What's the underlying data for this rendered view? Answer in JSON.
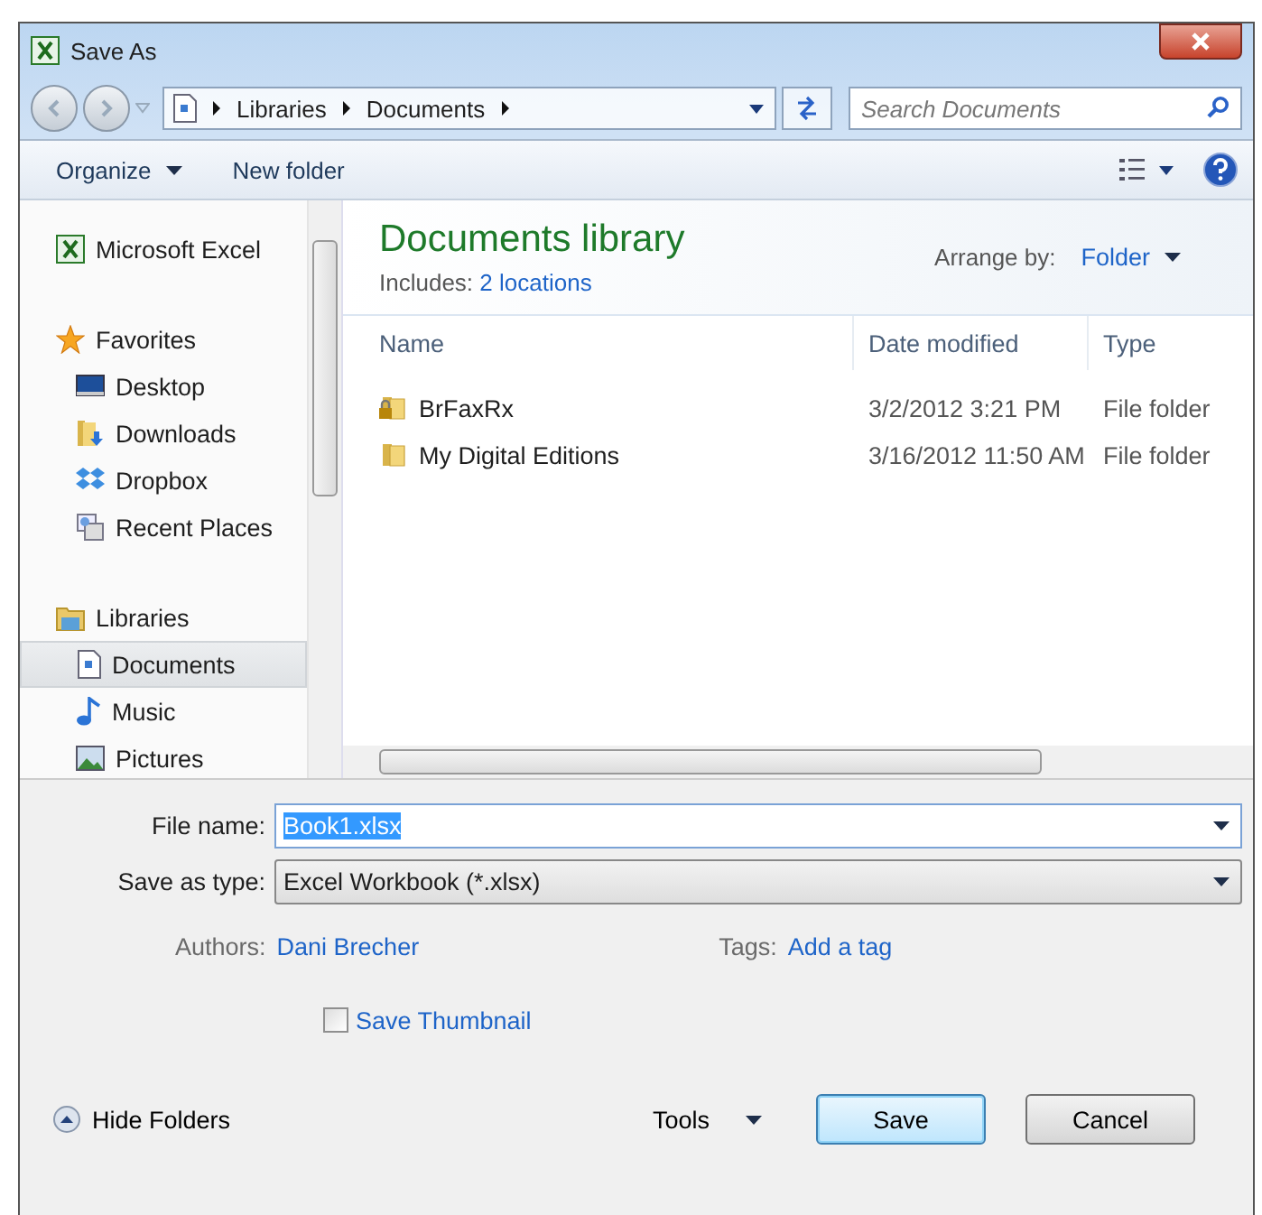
{
  "window": {
    "title": "Save As"
  },
  "address": {
    "crumbs": [
      "Libraries",
      "Documents"
    ]
  },
  "search": {
    "placeholder": "Search Documents"
  },
  "toolbar": {
    "organize": "Organize",
    "new_folder": "New folder"
  },
  "sidebar": {
    "groups": [
      {
        "label": "Microsoft Excel",
        "kind": "excel"
      },
      {
        "label": "Favorites",
        "kind": "star",
        "items": [
          {
            "label": "Desktop",
            "kind": "desktop",
            "selected": false
          },
          {
            "label": "Downloads",
            "kind": "downloads",
            "selected": false
          },
          {
            "label": "Dropbox",
            "kind": "dropbox",
            "selected": false
          },
          {
            "label": "Recent Places",
            "kind": "recent",
            "selected": false
          }
        ]
      },
      {
        "label": "Libraries",
        "kind": "library",
        "items": [
          {
            "label": "Documents",
            "kind": "document",
            "selected": true
          },
          {
            "label": "Music",
            "kind": "music",
            "selected": false
          },
          {
            "label": "Pictures",
            "kind": "pictures",
            "selected": false
          }
        ]
      }
    ]
  },
  "library": {
    "title": "Documents library",
    "includes_label": "Includes:",
    "includes_link": "2 locations",
    "arrange_label": "Arrange by:",
    "arrange_value": "Folder"
  },
  "table": {
    "columns": [
      "Name",
      "Date modified",
      "Type"
    ],
    "rows": [
      {
        "name": "BrFaxRx",
        "locked": true,
        "date": "3/2/2012 3:21 PM",
        "type": "File folder"
      },
      {
        "name": "My Digital Editions",
        "locked": false,
        "date": "3/16/2012 11:50 AM",
        "type": "File folder"
      }
    ]
  },
  "form": {
    "file_name_label": "File name:",
    "file_name": "Book1.xlsx",
    "type_label": "Save as type:",
    "type_value": "Excel Workbook (*.xlsx)",
    "authors_label": "Authors:",
    "authors": "Dani Brecher",
    "tags_label": "Tags:",
    "tags": "Add a tag",
    "thumbnail_label": "Save Thumbnail",
    "thumbnail_checked": false
  },
  "footer": {
    "hide_folders": "Hide Folders",
    "tools": "Tools",
    "save": "Save",
    "cancel": "Cancel"
  }
}
